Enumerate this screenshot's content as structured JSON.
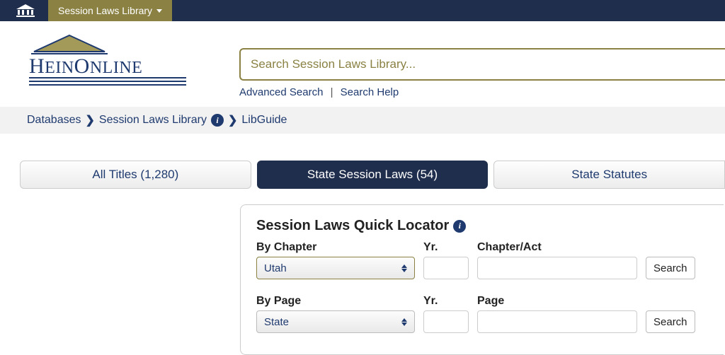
{
  "topbar": {
    "dropdown_label": "Session Laws Library"
  },
  "brand": {
    "name": "HEINONLINE"
  },
  "search": {
    "placeholder": "Search Session Laws Library...",
    "advanced": "Advanced Search",
    "help": "Search Help"
  },
  "breadcrumb": {
    "items": [
      "Databases",
      "Session Laws Library",
      "LibGuide"
    ]
  },
  "tabs": [
    {
      "label": "All Titles (1,280)",
      "active": false
    },
    {
      "label": "State Session Laws (54)",
      "active": true
    },
    {
      "label": "State Statutes",
      "active": false
    }
  ],
  "locator": {
    "title": "Session Laws Quick Locator",
    "by_chapter": {
      "label": "By Chapter",
      "state_selected": "Utah",
      "year_label": "Yr.",
      "chapter_label": "Chapter/Act",
      "search_btn": "Search"
    },
    "by_page": {
      "label": "By Page",
      "state_selected": "State",
      "year_label": "Yr.",
      "page_label": "Page",
      "search_btn": "Search"
    }
  }
}
